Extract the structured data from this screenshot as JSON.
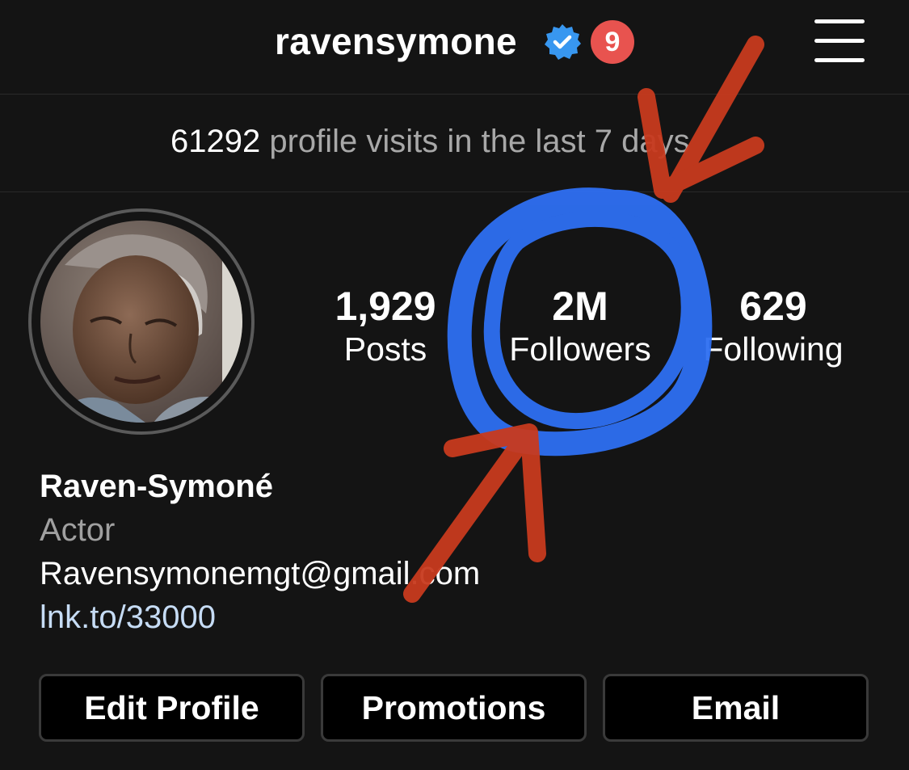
{
  "header": {
    "username": "ravensymone",
    "notification_count": "9"
  },
  "visits": {
    "count": "61292",
    "text": "profile visits in the last 7 days"
  },
  "stats": [
    {
      "value": "1,929",
      "label": "Posts"
    },
    {
      "value": "2M",
      "label": "Followers"
    },
    {
      "value": "629",
      "label": "Following"
    }
  ],
  "bio": {
    "name": "Raven-Symoné",
    "category": "Actor",
    "email": "Ravensymonemgt@gmail.com",
    "link": "lnk.to/33000"
  },
  "buttons": {
    "edit_profile": "Edit Profile",
    "promotions": "Promotions",
    "email": "Email"
  },
  "colors": {
    "background": "#141414",
    "verified_badge": "#3897f0",
    "notification_badge": "#e8534f",
    "link": "#c6dcf5",
    "annotation_circle": "#2e6ff2",
    "annotation_arrows": "#c83a1e"
  },
  "icons": {
    "verified": "verified-badge-icon",
    "menu": "hamburger-menu-icon"
  }
}
